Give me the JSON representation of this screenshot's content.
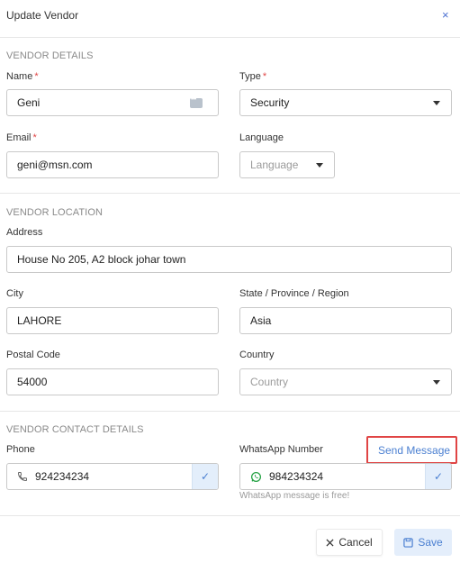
{
  "dialog": {
    "title": "Update Vendor",
    "close_symbol": "×"
  },
  "vendor_details": {
    "heading": "VENDOR DETAILS",
    "name_label": "Name",
    "name_value": "Geni",
    "type_label": "Type",
    "type_value": "Security",
    "email_label": "Email",
    "email_value": "geni@msn.com",
    "language_label": "Language",
    "language_placeholder": "Language",
    "required_mark": "*"
  },
  "vendor_location": {
    "heading": "VENDOR LOCATION",
    "address_label": "Address",
    "address_value": "House No 205, A2 block johar town",
    "city_label": "City",
    "city_value": "LAHORE",
    "state_label": "State / Province / Region",
    "state_value": "Asia",
    "postal_label": "Postal Code",
    "postal_value": "54000",
    "country_label": "Country",
    "country_placeholder": "Country"
  },
  "vendor_contact": {
    "heading": "VENDOR CONTACT DETAILS",
    "phone_label": "Phone",
    "phone_value": "924234234",
    "whatsapp_label": "WhatsApp Number",
    "whatsapp_value": "984234324",
    "send_message": "Send Message",
    "whatsapp_hint": "WhatsApp message is free!",
    "check_symbol": "✓"
  },
  "footer": {
    "cancel_label": "Cancel",
    "save_label": "Save"
  },
  "icons": {
    "close": "close-icon",
    "password_manager": "dots-icon",
    "dropdown": "chevron-down-icon",
    "phone": "phone-icon",
    "whatsapp": "whatsapp-icon",
    "check": "check-icon",
    "save": "save-icon",
    "cancel": "x-icon"
  },
  "colors": {
    "accent": "#4a7fd1",
    "required": "#e04545",
    "highlight_border": "#e04545",
    "whatsapp_green": "#25a244"
  }
}
